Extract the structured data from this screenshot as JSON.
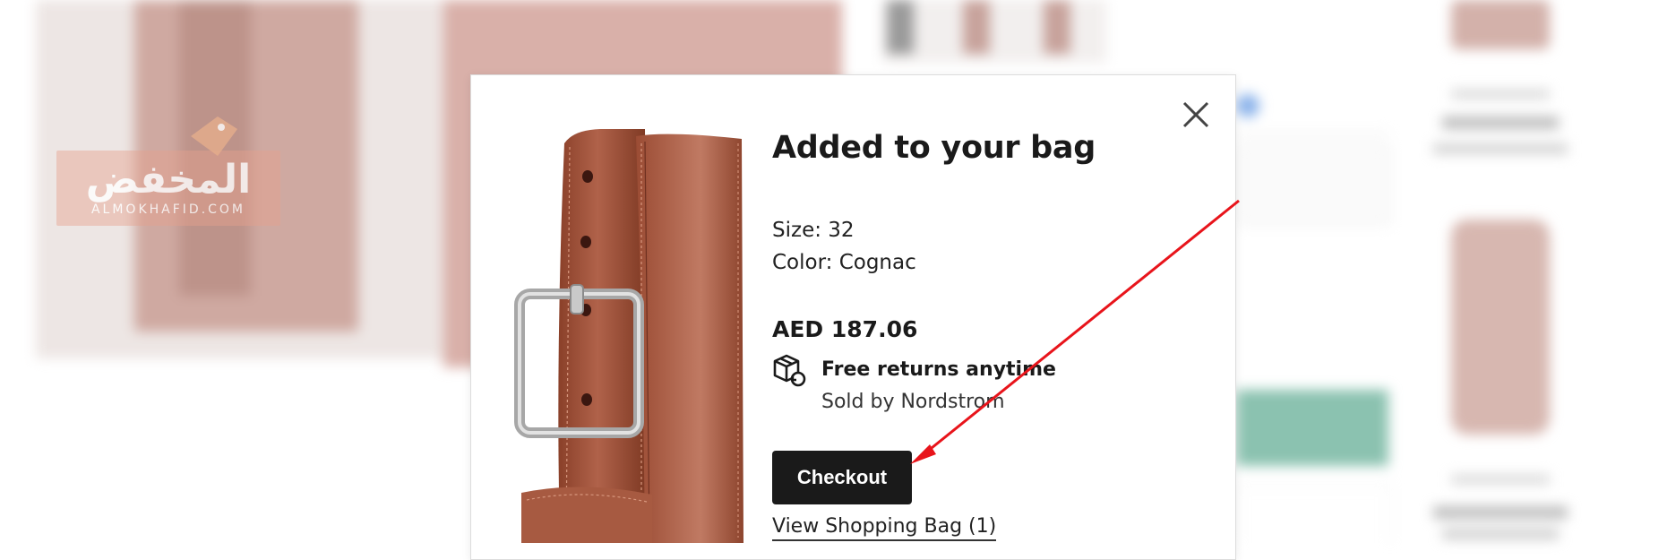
{
  "modal": {
    "title": "Added to your bag",
    "size_text": "Size: 32",
    "color_text": "Color: Cognac",
    "price": "AED 187.06",
    "returns_text": "Free returns anytime",
    "sold_by_text": "Sold by Nordstrom",
    "checkout_label": "Checkout",
    "view_bag_label": "View Shopping Bag (1)",
    "close_icon": "close-icon",
    "returns_icon": "box-return-icon"
  },
  "watermark": {
    "arabic_text": "المخفض",
    "latin_text": "ALMOKHAFID.COM"
  },
  "colors": {
    "checkout_bg": "#1a1a1a",
    "annotation_arrow": "#e8141b",
    "belt_brown": "#a0533a"
  }
}
